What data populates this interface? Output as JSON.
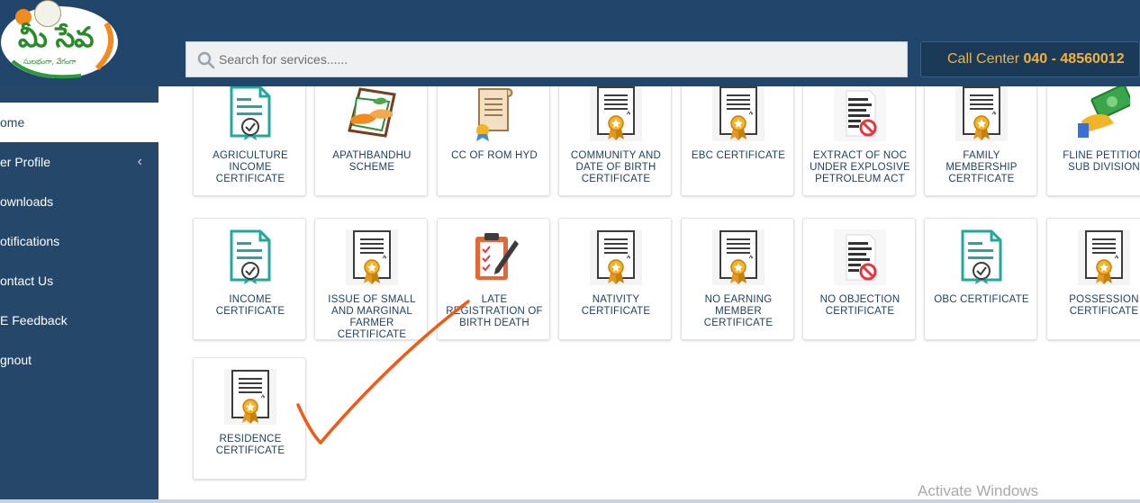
{
  "header": {
    "logo_text": "మీ సేవ",
    "logo_tagline": "సులభంగా, వేగంగా",
    "search_placeholder": "Search for services......",
    "call_center_label": "Call Center",
    "call_center_number": "040 - 48560012"
  },
  "sidebar": {
    "items": [
      {
        "label": "ome"
      },
      {
        "label": "er Profile"
      },
      {
        "label": "ownloads"
      },
      {
        "label": "otifications"
      },
      {
        "label": "ontact Us"
      },
      {
        "label": "E Feedback"
      },
      {
        "label": "gnout"
      }
    ]
  },
  "tiles": [
    {
      "label": "AGRICULTURE INCOME CERTIFICATE",
      "icon": "certificate-teal-icon"
    },
    {
      "label": "APATHBANDHU SCHEME",
      "icon": "helping-hands-icon"
    },
    {
      "label": "CC OF ROM HYD",
      "icon": "scroll-document-icon"
    },
    {
      "label": "COMMUNITY AND DATE OF BIRTH CERTIFICATE",
      "icon": "certificate-badge-icon"
    },
    {
      "label": "EBC CERTIFICATE",
      "icon": "certificate-badge-icon"
    },
    {
      "label": "EXTRACT OF NOC UNDER EXPLOSIVE PETROLEUM ACT",
      "icon": "no-objection-icon"
    },
    {
      "label": "FAMILY MEMBERSHIP CERTFICATE",
      "icon": "certificate-badge-icon"
    },
    {
      "label": "FLINE PETITION SUB DIVISION",
      "icon": "money-hand-icon"
    },
    {
      "label": "INCOME CERTIFICATE",
      "icon": "certificate-teal-icon"
    },
    {
      "label": "ISSUE OF SMALL AND MARGINAL FARMER CERTIFICATE",
      "icon": "certificate-badge-icon"
    },
    {
      "label": "LATE REGISTRATION OF BIRTH DEATH",
      "icon": "clipboard-checklist-icon"
    },
    {
      "label": "NATIVITY CERTIFICATE",
      "icon": "certificate-badge-icon"
    },
    {
      "label": "NO EARNING MEMBER CERTIFICATE",
      "icon": "certificate-badge-icon"
    },
    {
      "label": "NO OBJECTION CERTIFICATE",
      "icon": "no-objection-icon"
    },
    {
      "label": "OBC CERTIFICATE",
      "icon": "certificate-teal-icon"
    },
    {
      "label": "POSSESSION CERTIFICATE",
      "icon": "certificate-badge-icon"
    },
    {
      "label": "RESIDENCE CERTIFICATE",
      "icon": "certificate-badge-icon"
    }
  ],
  "watermark": "Activate Windows",
  "colors": {
    "header_bg": "#22466b",
    "sidebar_bg": "#24476a",
    "call_center_text": "#f2b33d",
    "label_text": "#1e3f5e",
    "annotation_check": "#f05a14"
  }
}
